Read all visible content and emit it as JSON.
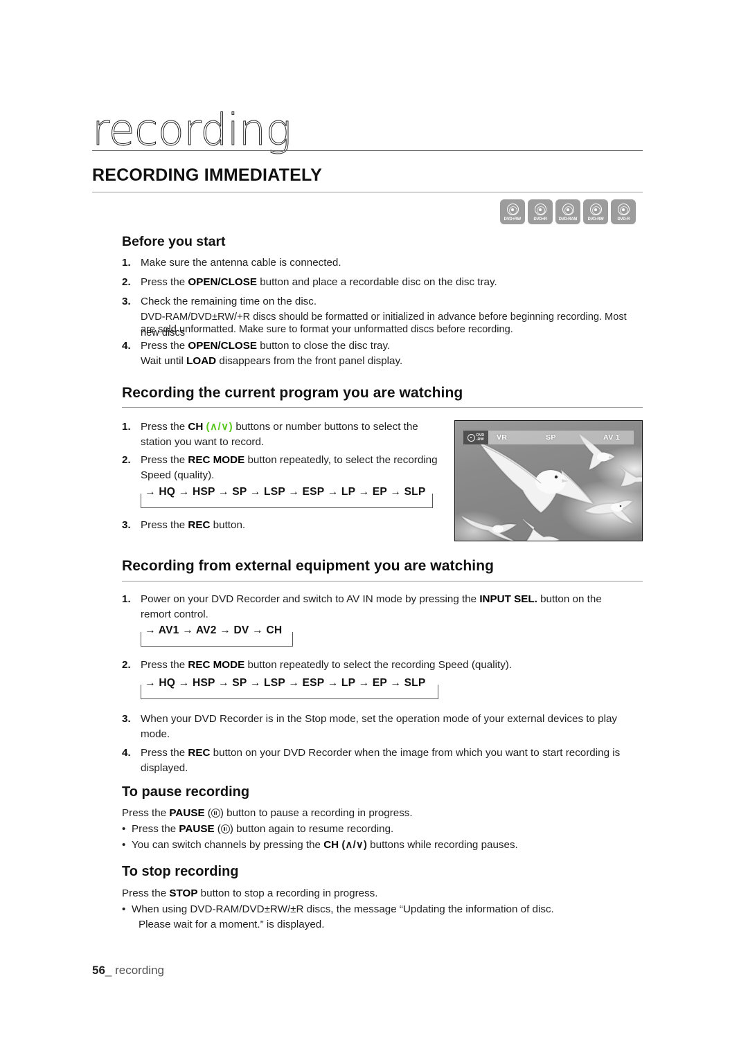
{
  "page": {
    "chapter_title": "recording",
    "section_title": "RECORDING IMMEDIATELY",
    "footer_page_number": "56",
    "footer_label": "recording"
  },
  "disc_badges": [
    {
      "label": "DVD+RW",
      "icon": "disc-icon"
    },
    {
      "label": "DVD+R",
      "icon": "disc-icon"
    },
    {
      "label": "DVD-RAM",
      "icon": "disc-icon"
    },
    {
      "label": "DVD-RW",
      "icon": "disc-icon"
    },
    {
      "label": "DVD-R",
      "icon": "disc-icon"
    }
  ],
  "before_you_start": {
    "heading": "Before you start",
    "items": [
      {
        "num": "1.",
        "text": "Make sure the antenna cable is connected."
      },
      {
        "num": "2.",
        "pre": "Press the ",
        "bold": "OPEN/CLOSE",
        "post": " button and place a recordable disc on the disc tray."
      },
      {
        "num": "3.",
        "text": "Check the remaining time on the disc."
      },
      {
        "num": "4.",
        "pre": "Press the ",
        "bold": "OPEN/CLOSE",
        "post": " button to close the disc tray."
      }
    ],
    "item3_note_line1": "DVD-RAM/DVD±RW/+R discs should be formatted or initialized in advance before beginning recording. Most new discs",
    "item3_note_line2": "are sold unformatted. Make sure to format your unformatted discs before recording.",
    "item4_note_pre": "Wait until ",
    "item4_note_bold": "LOAD",
    "item4_note_post": " disappears from the front panel display."
  },
  "recording_current": {
    "heading": "Recording the current program you are watching",
    "item1": {
      "num": "1.",
      "pre": "Press the ",
      "bold": "CH",
      "green": "(∧/∨)",
      "post": " buttons or number buttons to select the",
      "line2": "station you want to record."
    },
    "item2": {
      "num": "2.",
      "pre": "Press the ",
      "bold": "REC MODE",
      "post": " button repeatedly, to select the recording",
      "line2": "Speed (quality)."
    },
    "rec_mode_cycle": "HQ → HSP → SP → LSP → ESP → LP → EP → SLP",
    "item3": {
      "num": "3.",
      "pre": "Press the ",
      "bold": "REC",
      "post": " button."
    },
    "tv_osd": {
      "disc_line1": "DVD",
      "disc_line2": "-RW",
      "mode": "VR",
      "speed": "SP",
      "input": "AV 1"
    }
  },
  "recording_external": {
    "heading": "Recording from external equipment you are watching",
    "item1": {
      "num": "1.",
      "pre": "Power on your DVD Recorder and switch to AV IN mode by pressing the ",
      "bold": "INPUT SEL.",
      "post": " button on the",
      "line2": "remort control."
    },
    "input_cycle": "AV1 → AV2 → DV → CH",
    "item2": {
      "num": "2.",
      "pre": "Press the ",
      "bold": "REC MODE",
      "post": " button repeatedly to select the recording Speed (quality)."
    },
    "rec_mode_cycle": "HQ → HSP → SP → LSP → ESP → LP → EP → SLP",
    "item3": {
      "num": "3.",
      "text": "When your DVD Recorder is in the Stop mode, set the operation mode of your external devices to play",
      "line2": "mode."
    },
    "item4": {
      "num": "4.",
      "pre": "Press the ",
      "bold": "REC",
      "post": " button on your DVD Recorder when the image from which you want to start recording is",
      "line2": "displayed."
    }
  },
  "pause_recording": {
    "heading": "To pause recording",
    "line1_pre": "Press the ",
    "line1_bold": "PAUSE",
    "line1_post": " button to pause a recording in progress.",
    "bullet1_pre": "Press the ",
    "bullet1_bold": "PAUSE",
    "bullet1_post": " button again to resume recording.",
    "bullet2_pre": "You can switch channels by pressing the ",
    "bullet2_bold": "CH",
    "bullet2_symbol": "(∧/∨)",
    "bullet2_post": " buttons while recording pauses."
  },
  "stop_recording": {
    "heading": "To stop recording",
    "line1_pre": "Press the ",
    "line1_bold": "STOP",
    "line1_post": " button to stop a recording in progress.",
    "bullet1_line1": "When using DVD-RAM/DVD±RW/±R discs, the message “Updating the information of disc.",
    "bullet1_line2": "Please wait for a moment.” is displayed."
  },
  "colors": {
    "green_accent": "#5ac81e",
    "badge_gray": "#9c9c9c",
    "rule_gray": "#9a9a9a"
  }
}
